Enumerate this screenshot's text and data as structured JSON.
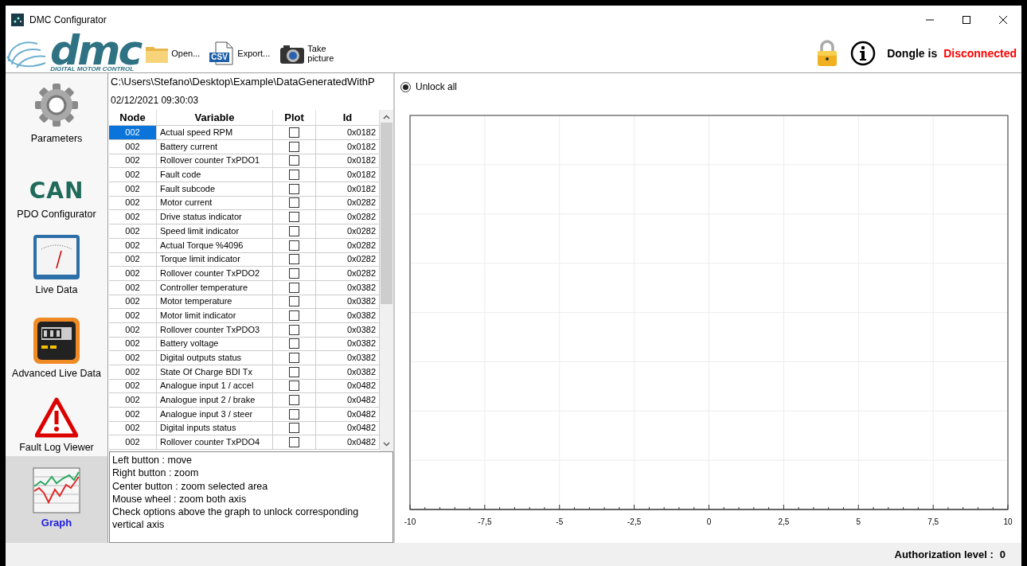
{
  "window": {
    "title": "DMC Configurator"
  },
  "toolbar": {
    "logo": {
      "wordmark": "dmc",
      "tagline": "DIGITAL MOTOR CONTROL"
    },
    "buttons": [
      {
        "kind": "open",
        "label": "Open..."
      },
      {
        "kind": "export",
        "label": "Export...",
        "icon_text": "CSV"
      },
      {
        "kind": "camera",
        "label": "Take picture"
      }
    ],
    "dongle": {
      "label": "Dongle is",
      "status": "Disconnected",
      "connected": false
    }
  },
  "sidebar": {
    "items": [
      {
        "kind": "gear",
        "label": "Parameters",
        "selected": false
      },
      {
        "kind": "can",
        "label": "PDO Configurator",
        "icon_text": "CAN",
        "selected": false
      },
      {
        "kind": "gauge",
        "label": "Live Data",
        "selected": false
      },
      {
        "kind": "meter",
        "label": "Advanced Live Data",
        "selected": false
      },
      {
        "kind": "warning",
        "label": "Fault Log Viewer",
        "selected": false
      },
      {
        "kind": "graph",
        "label": "Graph",
        "selected": true
      }
    ]
  },
  "data_file": {
    "path": "C:\\Users\\Stefano\\Desktop\\Example\\DataGeneratedWithP",
    "date": "02/12/2021 09:30:03"
  },
  "table": {
    "columns": [
      "Node",
      "Variable",
      "Plot",
      "Id"
    ],
    "rows": [
      {
        "node": "002",
        "variable": "Actual speed RPM",
        "plot": false,
        "id": "0x0182",
        "selected": true
      },
      {
        "node": "002",
        "variable": "Battery current",
        "plot": false,
        "id": "0x0182",
        "selected": false
      },
      {
        "node": "002",
        "variable": "Rollover counter TxPDO1",
        "plot": false,
        "id": "0x0182",
        "selected": false
      },
      {
        "node": "002",
        "variable": "Fault code",
        "plot": false,
        "id": "0x0182",
        "selected": false
      },
      {
        "node": "002",
        "variable": "Fault subcode",
        "plot": false,
        "id": "0x0182",
        "selected": false
      },
      {
        "node": "002",
        "variable": "Motor current",
        "plot": false,
        "id": "0x0282",
        "selected": false
      },
      {
        "node": "002",
        "variable": "Drive status indicator",
        "plot": false,
        "id": "0x0282",
        "selected": false
      },
      {
        "node": "002",
        "variable": "Speed limit indicator",
        "plot": false,
        "id": "0x0282",
        "selected": false
      },
      {
        "node": "002",
        "variable": "Actual Torque %4096",
        "plot": false,
        "id": "0x0282",
        "selected": false
      },
      {
        "node": "002",
        "variable": "Torque limit indicator",
        "plot": false,
        "id": "0x0282",
        "selected": false
      },
      {
        "node": "002",
        "variable": "Rollover counter TxPDO2",
        "plot": false,
        "id": "0x0282",
        "selected": false
      },
      {
        "node": "002",
        "variable": "Controller temperature",
        "plot": false,
        "id": "0x0382",
        "selected": false
      },
      {
        "node": "002",
        "variable": "Motor temperature",
        "plot": false,
        "id": "0x0382",
        "selected": false
      },
      {
        "node": "002",
        "variable": "Motor limit indicator",
        "plot": false,
        "id": "0x0382",
        "selected": false
      },
      {
        "node": "002",
        "variable": "Rollover counter TxPDO3",
        "plot": false,
        "id": "0x0382",
        "selected": false
      },
      {
        "node": "002",
        "variable": "Battery voltage",
        "plot": false,
        "id": "0x0382",
        "selected": false
      },
      {
        "node": "002",
        "variable": "Digital outputs status",
        "plot": false,
        "id": "0x0382",
        "selected": false
      },
      {
        "node": "002",
        "variable": "State Of Charge BDI Tx",
        "plot": false,
        "id": "0x0382",
        "selected": false
      },
      {
        "node": "002",
        "variable": "Analogue input 1 / accel",
        "plot": false,
        "id": "0x0482",
        "selected": false
      },
      {
        "node": "002",
        "variable": "Analogue input 2 / brake",
        "plot": false,
        "id": "0x0482",
        "selected": false
      },
      {
        "node": "002",
        "variable": "Analogue input 3 / steer",
        "plot": false,
        "id": "0x0482",
        "selected": false
      },
      {
        "node": "002",
        "variable": "Digital inputs status",
        "plot": false,
        "id": "0x0482",
        "selected": false
      },
      {
        "node": "002",
        "variable": "Rollover counter TxPDO4",
        "plot": false,
        "id": "0x0482",
        "selected": false
      }
    ]
  },
  "help_text": [
    "Left button : move",
    "Right button : zoom",
    "Center button : zoom selected area",
    "Mouse wheel : zoom both axis",
    "Check options above the graph to unlock corresponding vertical axis"
  ],
  "graph": {
    "unlock_all": {
      "label": "Unlock all",
      "checked": true
    },
    "x_axis_labels": [
      "-10",
      "-7,5",
      "-5",
      "-2,5",
      "0",
      "2,5",
      "5",
      "7,5",
      "10"
    ]
  },
  "status_bar": {
    "label": "Authorization level :",
    "value": "0"
  }
}
